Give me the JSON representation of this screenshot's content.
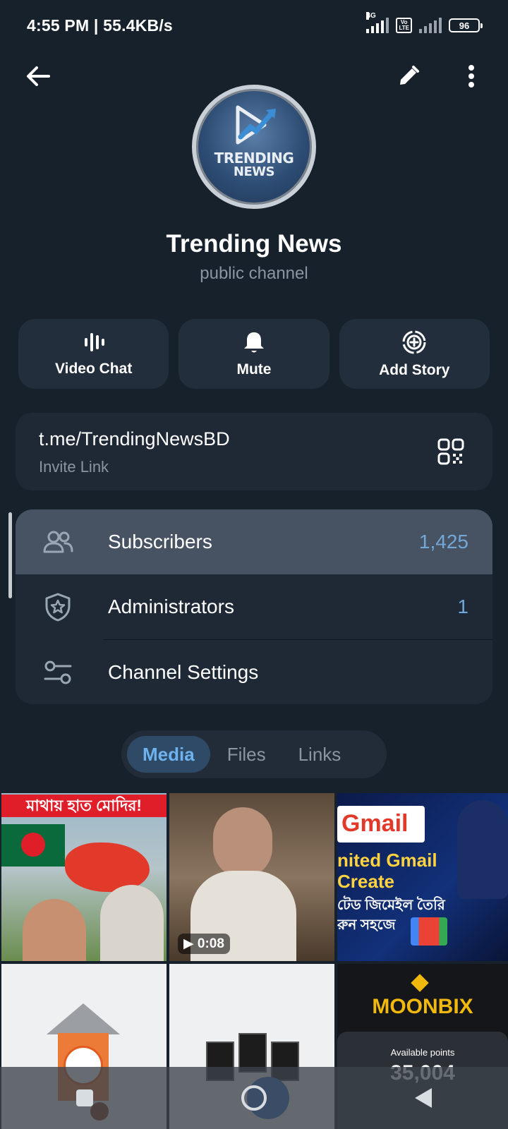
{
  "status_bar": {
    "time_speed": "4:55 PM | 55.4KB/s",
    "network_tag": "4G",
    "volte_line1": "Vo",
    "volte_line2": "LTE",
    "battery": "96"
  },
  "header": {
    "back_icon": "arrow-left-icon",
    "edit_icon": "pencil-icon",
    "more_icon": "more-vertical-icon"
  },
  "profile": {
    "avatar_text_line1": "TRENDING",
    "avatar_text_line2": "NEWS",
    "title": "Trending News",
    "subtitle": "public channel"
  },
  "actions": [
    {
      "label": "Video Chat",
      "icon": "voice-chat-icon"
    },
    {
      "label": "Mute",
      "icon": "bell-icon"
    },
    {
      "label": "Add Story",
      "icon": "add-story-icon"
    }
  ],
  "invite": {
    "url": "t.me/TrendingNewsBD",
    "caption": "Invite Link",
    "icon": "qr-code-icon"
  },
  "menu": [
    {
      "label": "Subscribers",
      "value": "1,425",
      "icon": "users-icon"
    },
    {
      "label": "Administrators",
      "value": "1",
      "icon": "shield-star-icon"
    },
    {
      "label": "Channel Settings",
      "value": "",
      "icon": "sliders-icon"
    }
  ],
  "tabs": [
    {
      "label": "Media",
      "active": true
    },
    {
      "label": "Files",
      "active": false
    },
    {
      "label": "Links",
      "active": false
    }
  ],
  "media": {
    "tile1_banner": "মাথায় হাত মোদির!",
    "tile2_duration": "0:08",
    "tile3_line1": "Gmail",
    "tile3_line2": "nited Gmail",
    "tile3_line3": "Create",
    "tile3_line4": "টেড জিমেইল তৈরি",
    "tile3_line5": "রুন সহজে",
    "tile6_title": "MOONBIX",
    "tile6_points_label": "Available points",
    "tile6_points": "35,004"
  },
  "colors": {
    "background": "#17212b",
    "card": "#1f2936",
    "accent": "#6eb2f0",
    "value_blue": "#72a8d8"
  }
}
